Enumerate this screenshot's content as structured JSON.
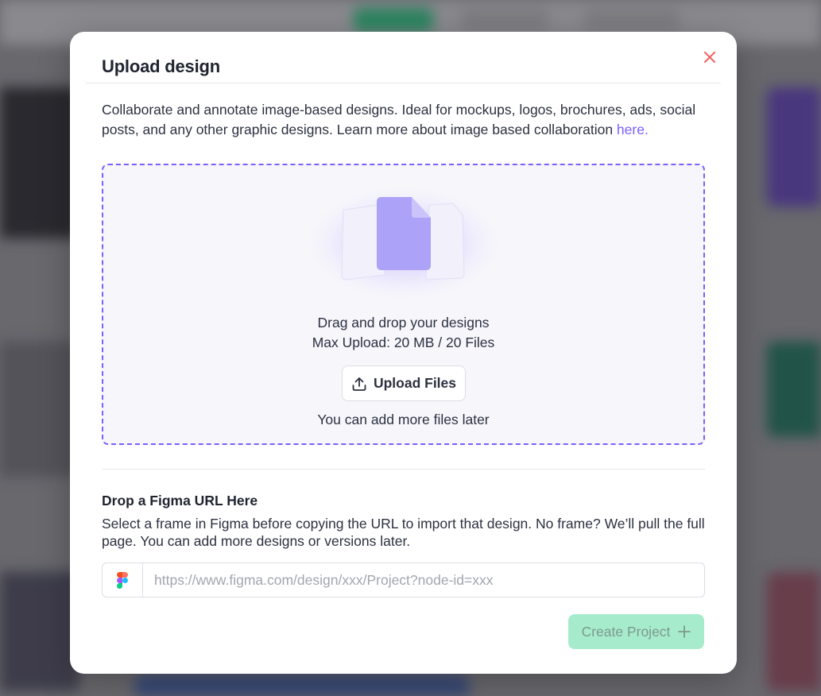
{
  "modal": {
    "title": "Upload design",
    "close_icon": "close-icon",
    "intro_text": "Collaborate and annotate image-based designs. Ideal for mockups, logos, brochures, ads, social posts, and any other graphic designs. Learn more about image based collaboration ",
    "intro_link": "here."
  },
  "dropzone": {
    "illustration_icon": "files-illustration",
    "line1": "Drag and drop your designs",
    "line2": "Max Upload: 20 MB / 20 Files",
    "upload_button": "Upload Files",
    "upload_icon": "upload-icon",
    "line3": "You can add more files later"
  },
  "figma": {
    "heading": "Drop a Figma URL Here",
    "description": "Select a frame in Figma before copying the URL to import that design. No frame? We’ll pull the full page. You can add more designs or versions later.",
    "icon": "figma-logo-icon",
    "placeholder": "https://www.figma.com/design/xxx/Project?node-id=xxx",
    "value": ""
  },
  "footer": {
    "create_button": "Create Project",
    "create_icon": "plus-icon"
  },
  "colors": {
    "accent": "#7b61ff",
    "close": "#f0605d",
    "create_button_bg": "#a7ebcd",
    "dropzone_bg": "#f6f6fb"
  }
}
